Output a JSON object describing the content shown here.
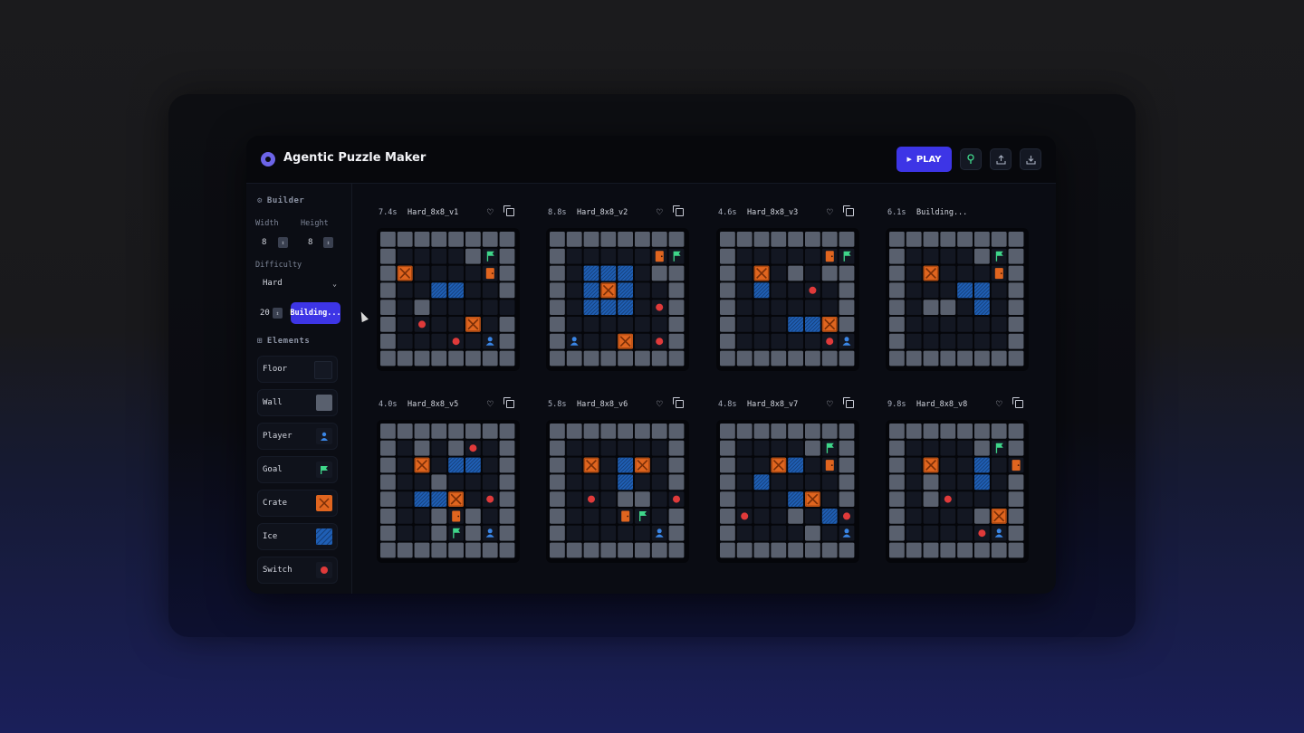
{
  "app": {
    "title": "Agentic Puzzle Maker"
  },
  "header": {
    "play_label": "PLAY",
    "play_icon": "play-icon",
    "icons": [
      "hint-icon",
      "upload-icon",
      "download-icon"
    ]
  },
  "sidebar": {
    "builder_label": "Builder",
    "width_label": "Width",
    "width_value": "8",
    "height_label": "Height",
    "height_value": "8",
    "difficulty_label": "Difficulty",
    "difficulty_value": "Hard",
    "count_value": "20",
    "build_button_label": "Building...",
    "elements_label": "Elements",
    "elements": [
      {
        "label": "Floor",
        "icon": "floor-swatch"
      },
      {
        "label": "Wall",
        "icon": "wall-swatch"
      },
      {
        "label": "Player",
        "icon": "player-icon"
      },
      {
        "label": "Goal",
        "icon": "flag-icon"
      },
      {
        "label": "Crate",
        "icon": "crate-icon"
      },
      {
        "label": "Ice",
        "icon": "ice-swatch"
      },
      {
        "label": "Switch",
        "icon": "switch-icon"
      }
    ]
  },
  "colors": {
    "accent": "#3d35e6",
    "floor": "#131722",
    "wall": "#59606e",
    "crate": "#e0651f",
    "ice": "#1f5fb5",
    "goal": "#3fd68a",
    "switch": "#e03a3a",
    "player": "#3a86e6",
    "door": "#e0651f"
  },
  "legend": {
    "W": "wall",
    ".": "floor",
    "X": "crate",
    "I": "ice",
    "G": "goal",
    "S": "switch",
    "P": "player",
    "D": "door"
  },
  "cards": [
    {
      "time": "7.4s",
      "name": "Hard_8x8_v1",
      "grid": [
        "WWWWWWWW",
        "W....WGW",
        "WX....DW",
        "W..II..W",
        "W.W.....",
        "W.S..X.W",
        "W...S.PW",
        "WWWWWWWW"
      ]
    },
    {
      "time": "8.8s",
      "name": "Hard_8x8_v2",
      "grid": [
        "WWWWWWWW",
        "W.....DG",
        "W.III.WW",
        "W.IXI..W",
        "W.III.SW",
        "W......W",
        "WP..X.SW",
        "WWWWWWWW"
      ]
    },
    {
      "time": "4.6s",
      "name": "Hard_8x8_v3",
      "grid": [
        "WWWWWWWW",
        "W.....DG",
        "W.X.W.WW",
        "W.I..S.W",
        "W......W",
        "W...IIXW",
        "W.....SP",
        "WWWWWWWW"
      ]
    },
    {
      "time": "6.1s",
      "name": "Building...",
      "grid": [
        "WWWWWWWW",
        "W....WGW",
        "W.X...DW",
        "W...II.W",
        "W.WW.I.W",
        "W......W",
        "W......W",
        "WWWWWWWW"
      ]
    },
    {
      "time": "4.0s",
      "name": "Hard_8x8_v5",
      "grid": [
        "WWWWWWWW",
        "W.W.WS.W",
        "W.X.II.W",
        "W..W...W",
        "W.IIX.SW",
        "W..WDW.W",
        "W..WGWPW",
        "WWWWWWWW"
      ]
    },
    {
      "time": "5.8s",
      "name": "Hard_8x8_v6",
      "grid": [
        "WWWWWWWW",
        "W......W",
        "W.X.IX.W",
        "W...I..W",
        "W.S.WW.S",
        "W...DG.W",
        "W.....PW",
        "WWWWWWWW"
      ]
    },
    {
      "time": "4.8s",
      "name": "Hard_8x8_v7",
      "grid": [
        "WWWWWWWW",
        "W....WGW",
        "W..XI.DW",
        "W.I....W",
        "W...IX.W",
        "WS..W.IS",
        "W....W.P",
        "WWWWWWWW"
      ]
    },
    {
      "time": "9.8s",
      "name": "Hard_8x8_v8",
      "grid": [
        "WWWWWWWW",
        "W....WGW",
        "W.X..I.D",
        "W.W..I.W",
        "W.WS...W",
        "W....WXW",
        "W....SPW",
        "WWWWWWWW"
      ]
    }
  ]
}
